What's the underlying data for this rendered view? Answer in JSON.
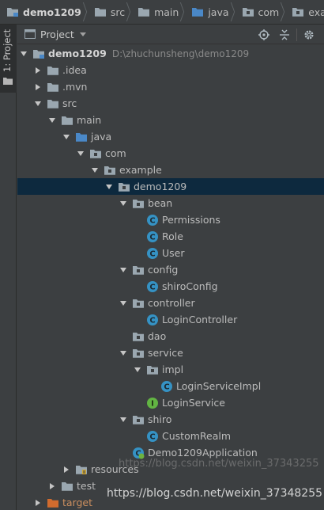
{
  "breadcrumb": [
    {
      "label": "demo1209",
      "bold": true,
      "icon": "project-folder-icon"
    },
    {
      "label": "src",
      "icon": "folder-icon"
    },
    {
      "label": "main",
      "icon": "folder-icon"
    },
    {
      "label": "java",
      "icon": "source-folder-icon"
    },
    {
      "label": "com",
      "icon": "package-icon"
    },
    {
      "label": "example",
      "icon": "package-icon"
    }
  ],
  "tool_strip": {
    "project_tab": "1: Project"
  },
  "panel": {
    "title": "Project",
    "actions": [
      "locate-icon",
      "collapse-all-icon",
      "settings-icon"
    ]
  },
  "tree": {
    "rows": [
      {
        "label": "demo1209",
        "hint": "D:\\zhuchunsheng\\demo1209",
        "depth": 0,
        "arrow": "down",
        "icon": "project-folder",
        "bold": true
      },
      {
        "label": ".idea",
        "depth": 1,
        "arrow": "right",
        "icon": "folder"
      },
      {
        "label": ".mvn",
        "depth": 1,
        "arrow": "right",
        "icon": "folder"
      },
      {
        "label": "src",
        "depth": 1,
        "arrow": "down",
        "icon": "folder"
      },
      {
        "label": "main",
        "depth": 2,
        "arrow": "down",
        "icon": "folder"
      },
      {
        "label": "java",
        "depth": 3,
        "arrow": "down",
        "icon": "source-folder"
      },
      {
        "label": "com",
        "depth": 4,
        "arrow": "down",
        "icon": "package"
      },
      {
        "label": "example",
        "depth": 5,
        "arrow": "down",
        "icon": "package"
      },
      {
        "label": "demo1209",
        "depth": 6,
        "arrow": "down",
        "icon": "package",
        "selected": true
      },
      {
        "label": "bean",
        "depth": 7,
        "arrow": "down",
        "icon": "package"
      },
      {
        "label": "Permissions",
        "depth": 8,
        "arrow": "none",
        "icon": "class"
      },
      {
        "label": "Role",
        "depth": 8,
        "arrow": "none",
        "icon": "class"
      },
      {
        "label": "User",
        "depth": 8,
        "arrow": "none",
        "icon": "class"
      },
      {
        "label": "config",
        "depth": 7,
        "arrow": "down",
        "icon": "package"
      },
      {
        "label": "shiroConfig",
        "depth": 8,
        "arrow": "none",
        "icon": "class"
      },
      {
        "label": "controller",
        "depth": 7,
        "arrow": "down",
        "icon": "package"
      },
      {
        "label": "LoginController",
        "depth": 8,
        "arrow": "none",
        "icon": "class"
      },
      {
        "label": "dao",
        "depth": 7,
        "arrow": "none",
        "icon": "package"
      },
      {
        "label": "service",
        "depth": 7,
        "arrow": "down",
        "icon": "package"
      },
      {
        "label": "impl",
        "depth": 8,
        "arrow": "down",
        "icon": "package"
      },
      {
        "label": "LoginServiceImpl",
        "depth": 9,
        "arrow": "none",
        "icon": "class"
      },
      {
        "label": "LoginService",
        "depth": 8,
        "arrow": "none",
        "icon": "interface"
      },
      {
        "label": "shiro",
        "depth": 7,
        "arrow": "down",
        "icon": "package"
      },
      {
        "label": "CustomRealm",
        "depth": 8,
        "arrow": "none",
        "icon": "class"
      },
      {
        "label": "Demo1209Application",
        "depth": 7,
        "arrow": "none",
        "icon": "spring-class"
      },
      {
        "label": "resources",
        "depth": 3,
        "arrow": "right",
        "icon": "resources-folder"
      },
      {
        "label": "test",
        "depth": 2,
        "arrow": "right",
        "icon": "folder"
      },
      {
        "label": "target",
        "depth": 1,
        "arrow": "right",
        "icon": "excluded-folder",
        "muted": true
      }
    ]
  },
  "watermark": {
    "text": "https://blog.csdn.net/weixin_37348255",
    "text_faint": "https://blog.csdn.net/weixin_37343255"
  }
}
